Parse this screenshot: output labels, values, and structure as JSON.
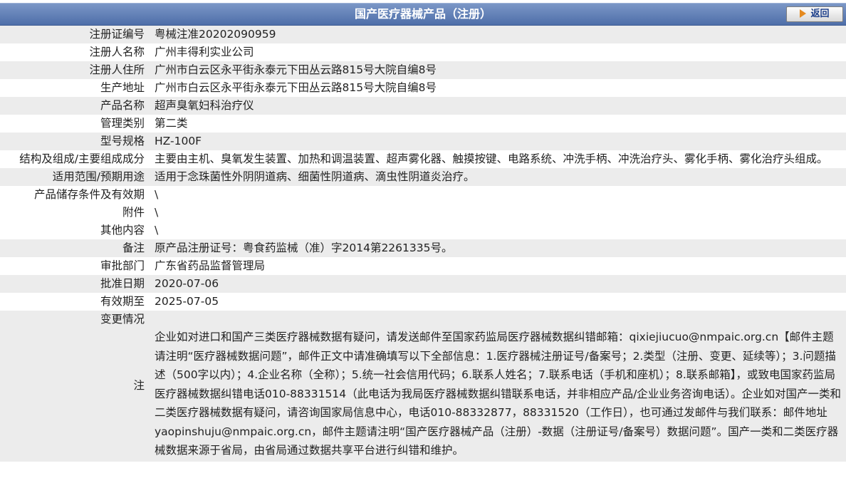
{
  "header": {
    "title": "国产医疗器械产品（注册）",
    "back_label": "返回"
  },
  "rows": [
    {
      "label": "注册证编号",
      "value": "粤械注准20202090959"
    },
    {
      "label": "注册人名称",
      "value": "广州丰得利实业公司"
    },
    {
      "label": "注册人住所",
      "value": "广州市白云区永平街永泰元下田丛云路815号大院自编8号"
    },
    {
      "label": "生产地址",
      "value": "广州市白云区永平街永泰元下田丛云路815号大院自编8号"
    },
    {
      "label": "产品名称",
      "value": "超声臭氧妇科治疗仪"
    },
    {
      "label": "管理类别",
      "value": "第二类"
    },
    {
      "label": "型号规格",
      "value": "HZ-100F"
    },
    {
      "label": "结构及组成/主要组成成分",
      "value": "主要由主机、臭氧发生装置、加热和调温装置、超声雾化器、触摸按键、电路系统、冲洗手柄、冲洗治疗头、雾化手柄、雾化治疗头组成。"
    },
    {
      "label": "适用范围/预期用途",
      "value": "适用于念珠菌性外阴阴道病、细菌性阴道病、滴虫性阴道炎治疗。"
    },
    {
      "label": "产品储存条件及有效期",
      "value": "\\"
    },
    {
      "label": "附件",
      "value": "\\"
    },
    {
      "label": "其他内容",
      "value": "\\"
    },
    {
      "label": "备注",
      "value": "原产品注册证号：粤食药监械（准）字2014第2261335号。"
    },
    {
      "label": "审批部门",
      "value": "广东省药品监督管理局"
    },
    {
      "label": "批准日期",
      "value": "2020-07-06"
    },
    {
      "label": "有效期至",
      "value": "2025-07-05"
    },
    {
      "label": "变更情况",
      "value": ""
    },
    {
      "label": "注",
      "value": "企业如对进口和国产三类医疗器械数据有疑问，请发送邮件至国家药监局医疗器械数据纠错邮箱：qixiejiucuo@nmpaic.org.cn【邮件主题请注明“医疗器械数据问题”，邮件正文中请准确填写以下全部信息：1.医疗器械注册证号/备案号；2.类型（注册、变更、延续等）；3.问题描述（500字以内）；4.企业名称（全称）；5.统一社会信用代码；6.联系人姓名；7.联系电话（手机和座机）；8.联系邮箱】，或致电国家药监局医疗器械数据纠错电话010-88331514（此电话为我局医疗器械数据纠错联系电话，并非相应产品/企业业务咨询电话）。企业如对国产一类和二类医疗器械数据有疑问，请咨询国家局信息中心，电话010-88332877，88331520（工作日），也可通过发邮件与我们联系：邮件地址yaopinshuju@nmpaic.org.cn，邮件主题请注明“国产医疗器械产品（注册）-数据（注册证号/备案号）数据问题”。国产一类和二类医疗器械数据来源于省局，由省局通过数据共享平台进行纠错和维护。"
    }
  ]
}
